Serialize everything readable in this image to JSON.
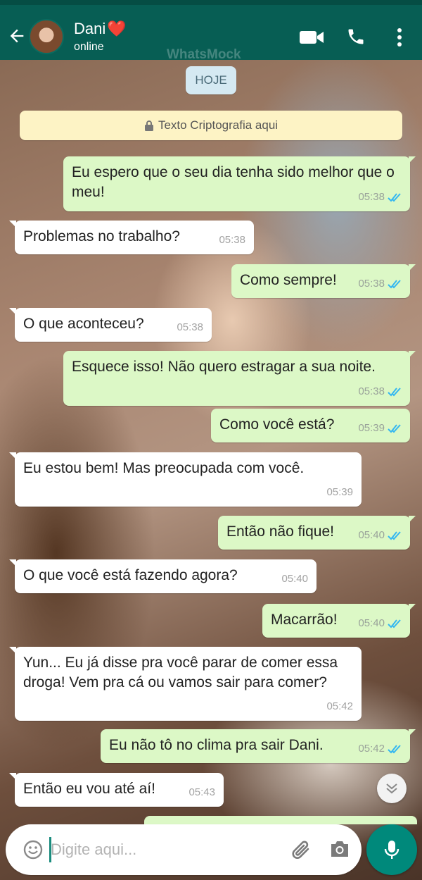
{
  "header": {
    "contact_name": "Dani",
    "contact_emoji": "❤️",
    "status": "online",
    "watermark": "WhatsMock",
    "icons": [
      "back-arrow-icon",
      "video-call-icon",
      "phone-icon",
      "more-vert-icon"
    ]
  },
  "chat": {
    "date_chip": "HOJE",
    "encryption_notice": "Texto Criptografia aqui",
    "messages": [
      {
        "dir": "out",
        "text": "Eu espero que o seu dia tenha sido melhor que o meu!",
        "time": "05:38",
        "read": true
      },
      {
        "dir": "in",
        "text": "Problemas no trabalho?",
        "time": "05:38"
      },
      {
        "dir": "out",
        "text": "Como sempre!",
        "time": "05:38",
        "read": true
      },
      {
        "dir": "in",
        "text": "O que aconteceu?",
        "time": "05:38"
      },
      {
        "dir": "out",
        "text": "Esquece isso! Não quero estragar a sua noite.",
        "time": "05:38",
        "read": true
      },
      {
        "dir": "out",
        "text": "Como você está?",
        "time": "05:39",
        "read": true
      },
      {
        "dir": "in",
        "text": "Eu estou bem! Mas preocupada com você.",
        "time": "05:39"
      },
      {
        "dir": "out",
        "text": "Então não fique!",
        "time": "05:40",
        "read": true
      },
      {
        "dir": "in",
        "text": "O que você está fazendo agora?",
        "time": "05:40"
      },
      {
        "dir": "out",
        "text": "Macarrão!",
        "time": "05:40",
        "read": true
      },
      {
        "dir": "in",
        "text": "Yun... Eu já disse pra você parar de comer essa droga! Vem pra cá ou vamos sair para comer?",
        "time": "05:42"
      },
      {
        "dir": "out",
        "text": "Eu não tô no clima pra sair Dani.",
        "time": "05:42",
        "read": true
      },
      {
        "dir": "in",
        "text": "Então eu vou até aí!",
        "time": "05:43"
      }
    ]
  },
  "composer": {
    "placeholder": "Digite aqui...",
    "value": "",
    "icons": [
      "emoji-icon",
      "attach-icon",
      "camera-icon",
      "mic-icon"
    ]
  },
  "colors": {
    "header": "#075e54",
    "outgoing_bubble": "#dcf8c6",
    "incoming_bubble": "#ffffff",
    "read_ticks": "#34b7f1",
    "mic_button": "#00897b"
  }
}
